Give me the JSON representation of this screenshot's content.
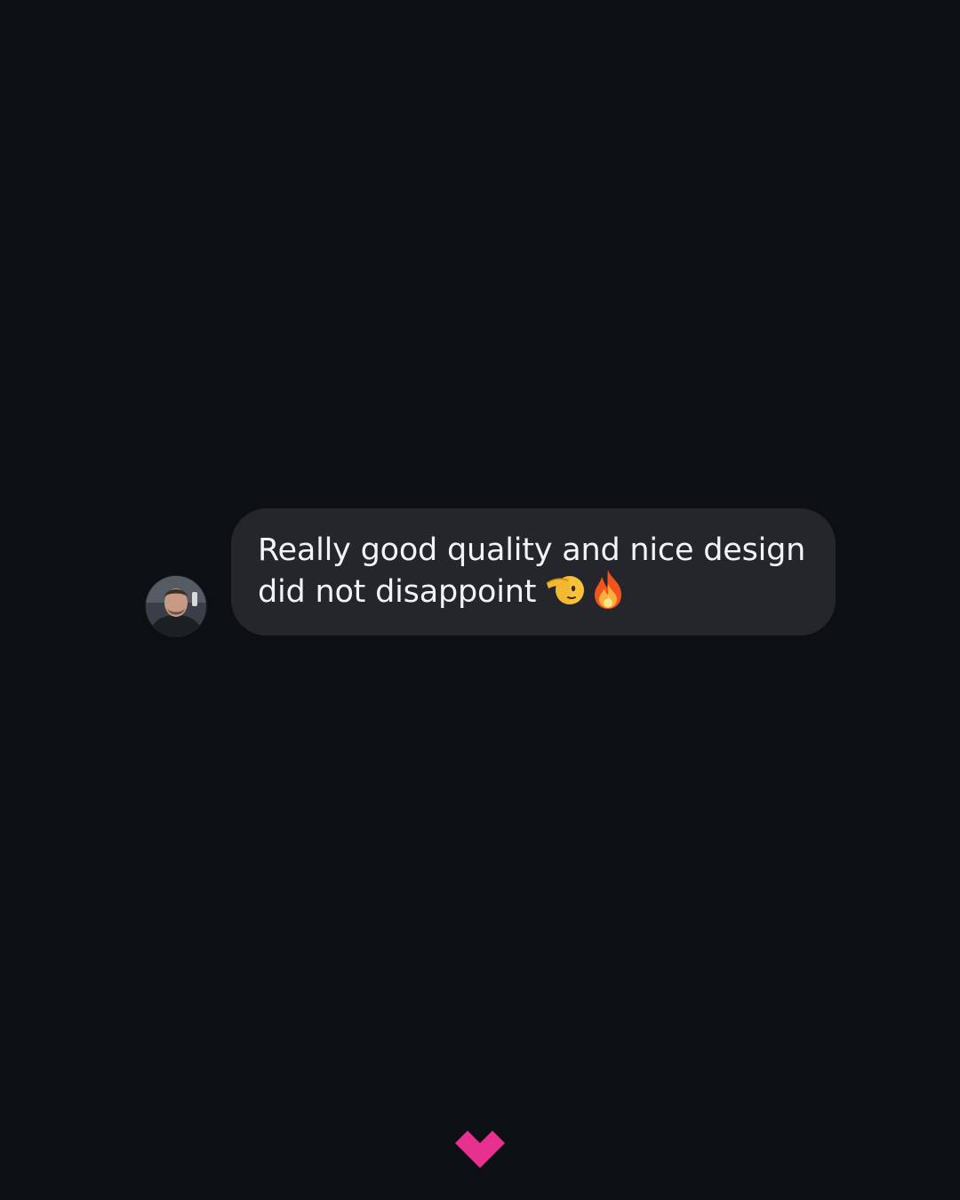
{
  "message": {
    "line1": "Really good quality and nice design",
    "line2": "did not disappoint",
    "emojis": [
      "saluting-face-icon",
      "fire-icon"
    ]
  },
  "avatar": {
    "icon": "profile-photo"
  },
  "colors": {
    "background": "#0c0f14",
    "bubble": "#24262b",
    "text": "#f2f3f5",
    "brand": "#e8308f"
  },
  "brand": {
    "icon": "heart-chevron-logo"
  }
}
